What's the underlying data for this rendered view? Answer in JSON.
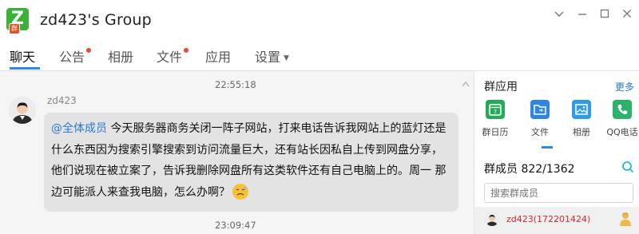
{
  "window": {
    "title": "zd423's Group",
    "logo_letter": "Z",
    "logo_badge": "群"
  },
  "tabs": [
    {
      "label": "聊天",
      "active": true
    },
    {
      "label": "公告",
      "dot": true
    },
    {
      "label": "相册"
    },
    {
      "label": "文件",
      "dot": true
    },
    {
      "label": "应用"
    },
    {
      "label": "设置",
      "dropdown": true
    }
  ],
  "chat": {
    "timestamp_1": "22:55:18",
    "sender": "zd423",
    "mention": "@全体成员",
    "message": " 今天服务器商务关闭一阵子网站，打来电话告诉我网站上的蓝灯还是什么东西因为搜索引擎搜索到访问流量巨大，还有站长因私自上传到网盘分享，他们说现在被立案了，告诉我删除网盘所有这类软件还有自己电脑上的。周一 那边可能派人来查我电脑，怎么办啊？",
    "timestamp_2": "23:09:47"
  },
  "panel": {
    "apps_title": "群应用",
    "more_label": "更多",
    "apps": [
      {
        "label": "群日历",
        "icon": "calendar-icon",
        "color": "#27a95a",
        "glyph": "7"
      },
      {
        "label": "文件",
        "icon": "folder-icon",
        "color": "#2f86e0"
      },
      {
        "label": "相册",
        "icon": "photo-icon",
        "color": "#2f9be6"
      },
      {
        "label": "QQ电话",
        "icon": "phone-icon",
        "color": "#2cb36a"
      }
    ],
    "members_title": "群成员",
    "member_count": "822/1362",
    "search_placeholder": "搜索群成员",
    "members": [
      {
        "name": "zd423(172201424)",
        "role_icon": "owner-icon"
      }
    ]
  },
  "colors": {
    "accent": "#2a8ce6",
    "mention": "#2a7ad4",
    "owner_name": "#d9262f",
    "brand_green": "#3bb13a"
  }
}
